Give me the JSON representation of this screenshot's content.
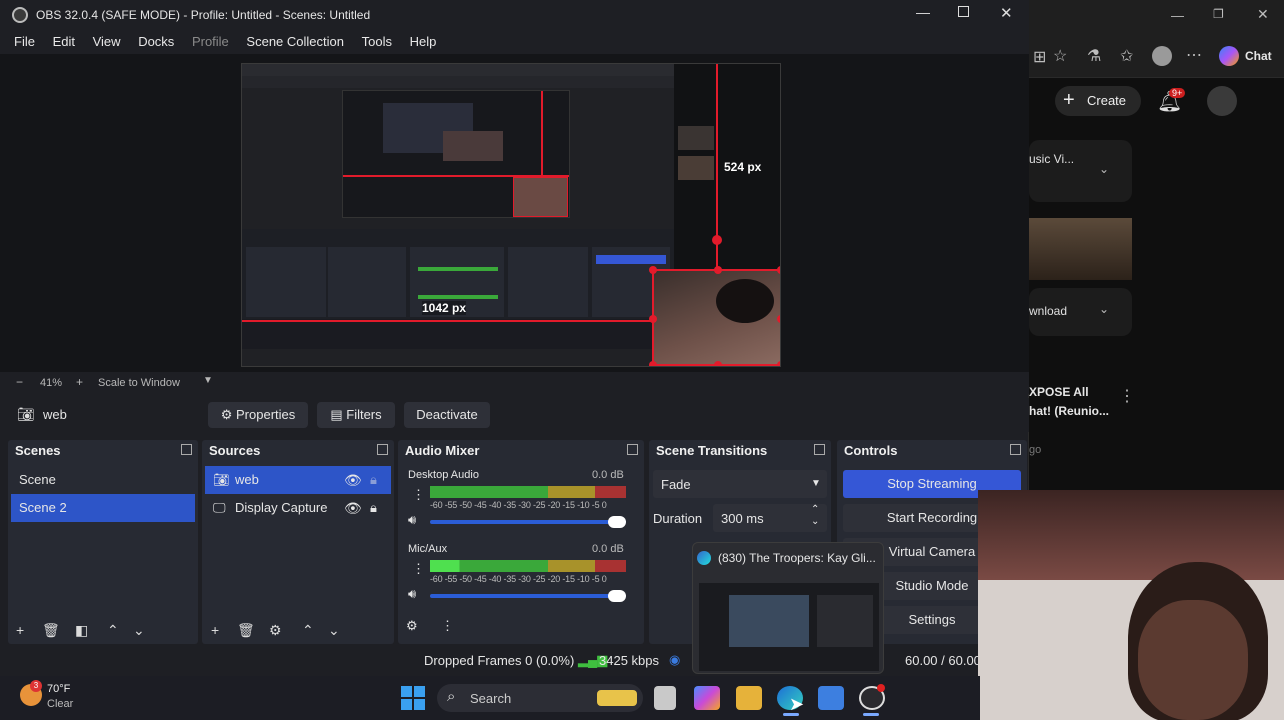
{
  "window": {
    "title": "OBS 32.0.4 (SAFE MODE) - Profile: Untitled - Scenes: Untitled"
  },
  "menu": [
    "File",
    "Edit",
    "View",
    "Docks",
    "Profile",
    "Scene Collection",
    "Tools",
    "Help"
  ],
  "preview": {
    "height_label": "524 px",
    "width_label": "1042 px",
    "zoom": "41%",
    "scale_mode": "Scale to Window"
  },
  "source_bar": {
    "selected_source": "web",
    "properties": "Properties",
    "filters": "Filters",
    "deactivate": "Deactivate"
  },
  "scenes": {
    "title": "Scenes",
    "items": [
      {
        "name": "Scene",
        "selected": false
      },
      {
        "name": "Scene 2",
        "selected": true
      }
    ]
  },
  "sources": {
    "title": "Sources",
    "items": [
      {
        "name": "web",
        "selected": true
      },
      {
        "name": "Display Capture",
        "selected": false
      }
    ]
  },
  "audio_mixer": {
    "title": "Audio Mixer",
    "channels": [
      {
        "name": "Desktop Audio",
        "level": "0.0 dB",
        "meter_fill": 0.05
      },
      {
        "name": "Mic/Aux",
        "level": "0.0 dB",
        "meter_fill": 0.18
      }
    ],
    "scale": "-60 -55 -50 -45 -40 -35 -30 -25 -20 -15 -10 -5 0"
  },
  "scene_transitions": {
    "title": "Scene Transitions",
    "transition": "Fade",
    "duration_label": "Duration",
    "duration": "300 ms"
  },
  "controls": {
    "title": "Controls",
    "stop_streaming": "Stop Streaming",
    "start_recording": "Start Recording",
    "virtual_camera": "Virtual Camera",
    "studio_mode": "Studio Mode",
    "settings": "Settings"
  },
  "status": {
    "dropped_frames": "Dropped Frames 0 (0.0%)",
    "bitrate": "3425 kbps",
    "fps": "60.00 / 60.00 F"
  },
  "tooltip": {
    "title": "(830) The Troopers: Kay Gli..."
  },
  "browser": {
    "chat": "Chat",
    "create": "Create",
    "notif_count": "9+",
    "card1": "usic Vi...",
    "card2": "wnload",
    "card3_line1": "XPOSE All",
    "card3_line2": "hat! (Reunio...",
    "card3_meta": "go"
  },
  "taskbar": {
    "weather_temp": "70°F",
    "weather_cond": "Clear",
    "search": "Search"
  },
  "colors": {
    "accent_blue": "#3557d6",
    "selection_blue": "#2d55c8",
    "bounding_red": "#e21b2b"
  }
}
